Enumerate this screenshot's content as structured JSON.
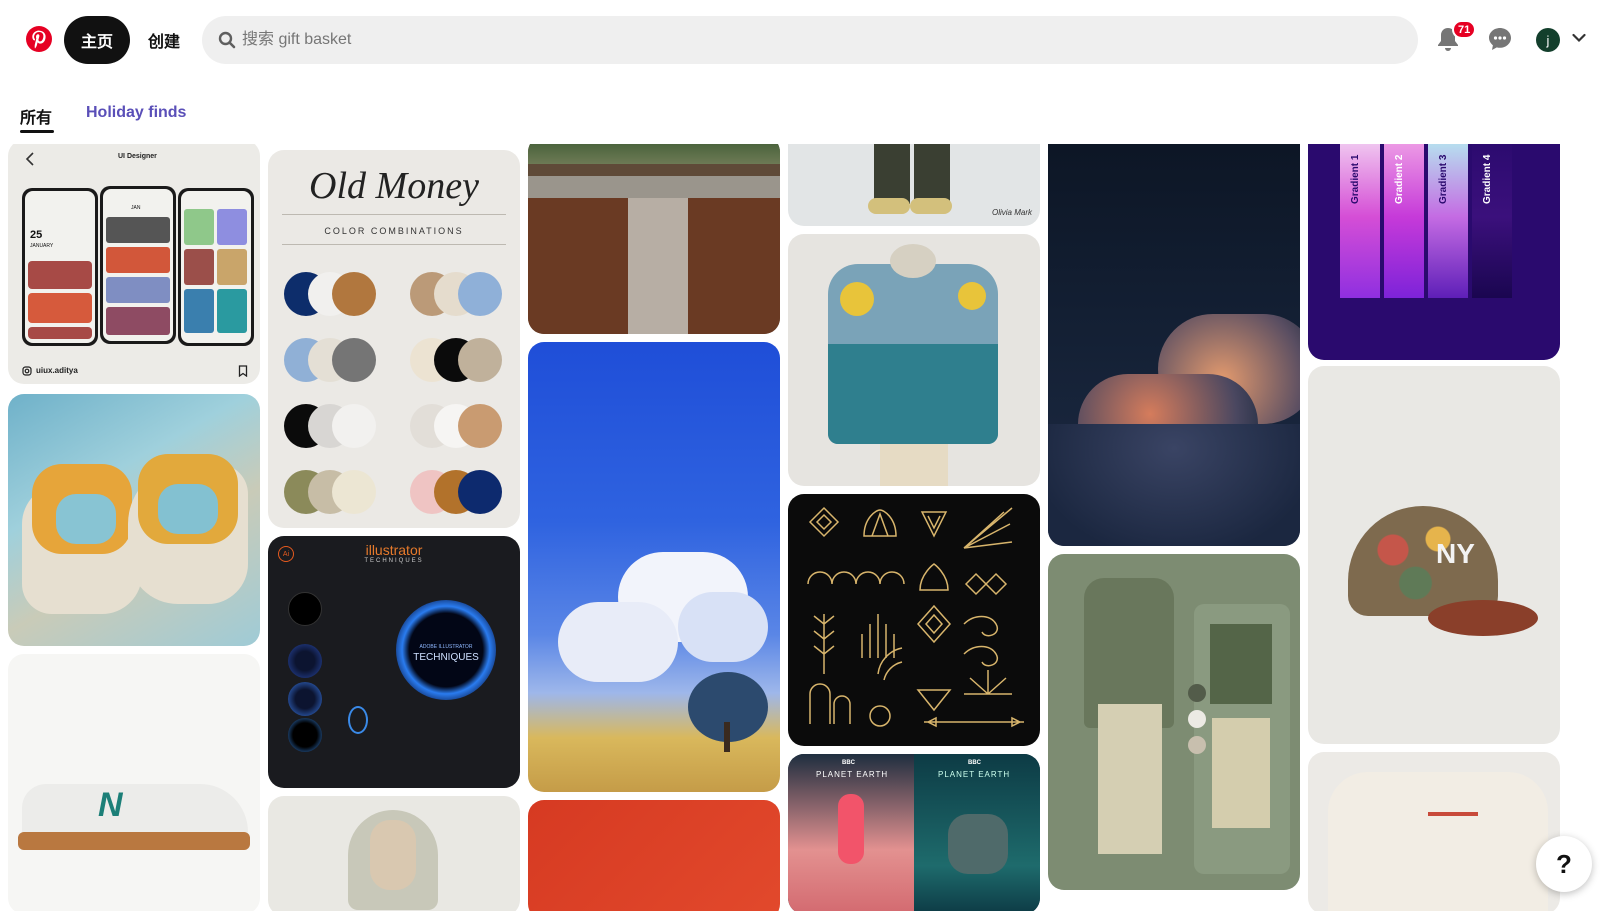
{
  "header": {
    "home_label": "主页",
    "create_label": "创建",
    "search_placeholder": "搜索 gift basket",
    "notification_count": "71",
    "avatar_initial": "j"
  },
  "tabs": [
    {
      "label": "所有",
      "active": true
    },
    {
      "label": "Holiday finds",
      "active": false
    }
  ],
  "pins": {
    "ui_designer": {
      "title": "UI Designer",
      "handle": "uiux.aditya",
      "date_num": "25",
      "month": "JANUARY",
      "calendar_month": "JAN"
    },
    "sneaker_yellow": {
      "alt": "yellow and blue sneakers"
    },
    "sneaker_nb": {
      "alt": "white new balance sneaker"
    },
    "old_money": {
      "title": "Old Money",
      "subtitle": "COLOR COMBINATIONS"
    },
    "illustrator": {
      "title": "illustrator",
      "subtitle": "TECHNIQUES",
      "center_small": "ADOBE ILLUSTRATOR",
      "center_big": "TECHNIQUES"
    },
    "hoodie": {
      "alt": "grey hoodie"
    },
    "kitchen": {
      "alt": "wood kitchen"
    },
    "sky_anime": {
      "alt": "anime sky and clouds"
    },
    "red_pin": {
      "alt": "red pin"
    },
    "pants_man": {
      "watermark": "Olivia Mark"
    },
    "smiley_jacket": {
      "alt": "smiley patch jacket"
    },
    "art_deco": {
      "alt": "art deco gold ornaments"
    },
    "planet_earth": {
      "label_left": "PLANET EARTH",
      "label_right": "PLANET EARTH",
      "brand": "BBC"
    },
    "cloud_night": {
      "alt": "clouds at night"
    },
    "green_outfit": {
      "alt": "green outfit"
    },
    "gradients": {
      "labels": [
        "Gradient 1",
        "Gradient 2",
        "Gradient 3",
        "Gradient 4"
      ]
    },
    "cap": {
      "alt": "floral NY cap"
    },
    "sweater": {
      "alt": "cream sweatshirt"
    }
  },
  "colors": {
    "brand": "#e60023",
    "tab_active": "#111111",
    "tab_link": "#5a4fb8"
  }
}
